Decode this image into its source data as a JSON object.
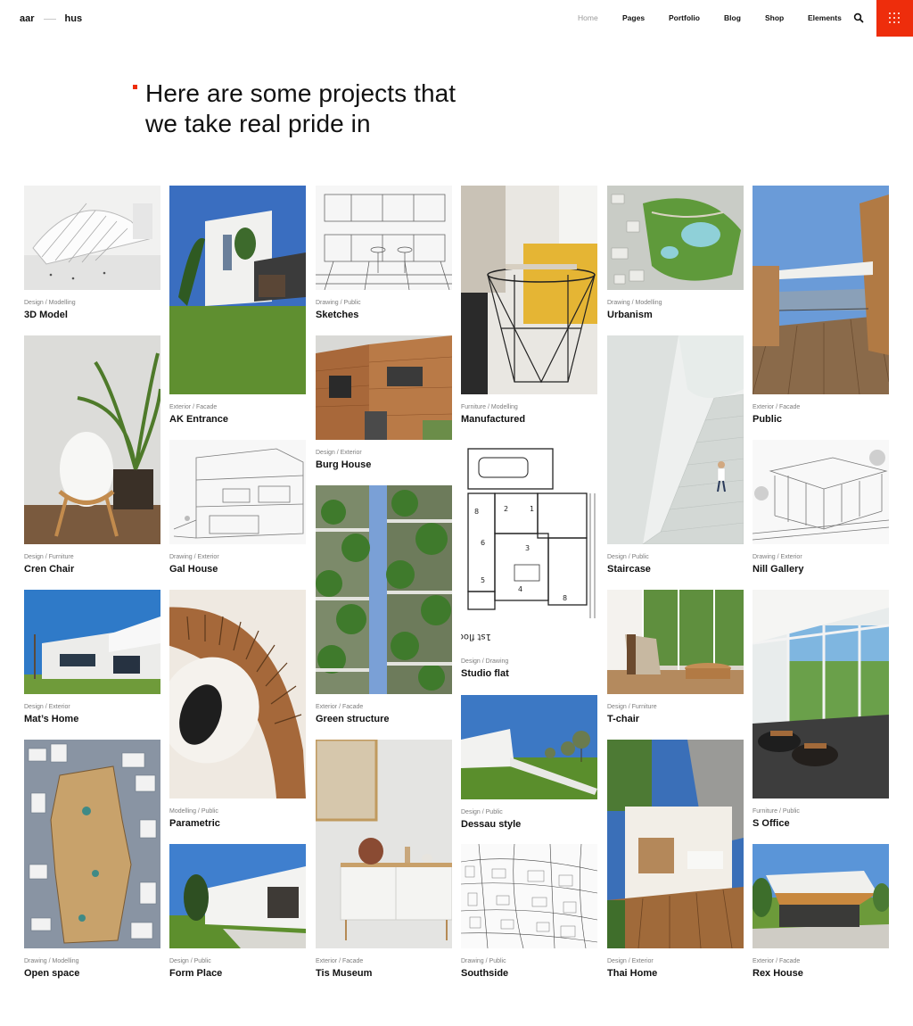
{
  "brand": {
    "left": "aar",
    "right": "hus"
  },
  "nav": {
    "items": [
      {
        "label": "Home",
        "active": true
      },
      {
        "label": "Pages"
      },
      {
        "label": "Portfolio"
      },
      {
        "label": "Blog"
      },
      {
        "label": "Shop"
      },
      {
        "label": "Elements"
      }
    ],
    "search_icon": "search-icon",
    "menu_icon": "grid-menu-icon"
  },
  "colors": {
    "accent": "#ee2d0c"
  },
  "heading": {
    "line1": "Here are some projects that",
    "line2": "we take real pride in"
  },
  "portfolio": {
    "columns": [
      [
        {
          "cat1": "Design",
          "cat2": "Modelling",
          "title": "3D Model"
        },
        {
          "cat1": "Design",
          "cat2": "Furniture",
          "title": "Cren Chair"
        },
        {
          "cat1": "Design",
          "cat2": "Exterior",
          "title": "Mat’s Home"
        },
        {
          "cat1": "Drawing",
          "cat2": "Modelling",
          "title": "Open space"
        }
      ],
      [
        {
          "cat1": "Exterior",
          "cat2": "Facade",
          "title": "AK Entrance"
        },
        {
          "cat1": "Drawing",
          "cat2": "Exterior",
          "title": "Gal House"
        },
        {
          "cat1": "Modelling",
          "cat2": "Public",
          "title": "Parametric"
        },
        {
          "cat1": "Design",
          "cat2": "Public",
          "title": "Form Place"
        }
      ],
      [
        {
          "cat1": "Drawing",
          "cat2": "Public",
          "title": "Sketches"
        },
        {
          "cat1": "Design",
          "cat2": "Exterior",
          "title": "Burg House"
        },
        {
          "cat1": "Exterior",
          "cat2": "Facade",
          "title": "Green structure"
        },
        {
          "cat1": "Exterior",
          "cat2": "Facade",
          "title": "Tis Museum"
        }
      ],
      [
        {
          "cat1": "Furniture",
          "cat2": "Modelling",
          "title": "Manufactured"
        },
        {
          "cat1": "Design",
          "cat2": "Drawing",
          "title": "Studio flat"
        },
        {
          "cat1": "Design",
          "cat2": "Public",
          "title": "Dessau style"
        },
        {
          "cat1": "Drawing",
          "cat2": "Public",
          "title": "Southside"
        }
      ],
      [
        {
          "cat1": "Drawing",
          "cat2": "Modelling",
          "title": "Urbanism"
        },
        {
          "cat1": "Design",
          "cat2": "Public",
          "title": "Staircase"
        },
        {
          "cat1": "Design",
          "cat2": "Furniture",
          "title": "T-chair"
        },
        {
          "cat1": "Design",
          "cat2": "Exterior",
          "title": "Thai Home"
        }
      ],
      [
        {
          "cat1": "Exterior",
          "cat2": "Facade",
          "title": "Public"
        },
        {
          "cat1": "Drawing",
          "cat2": "Exterior",
          "title": "Nill Gallery"
        },
        {
          "cat1": "Furniture",
          "cat2": "Public",
          "title": "S Office"
        },
        {
          "cat1": "Exterior",
          "cat2": "Facade",
          "title": "Rex House"
        }
      ]
    ],
    "floorplan_label": "1st floor"
  }
}
